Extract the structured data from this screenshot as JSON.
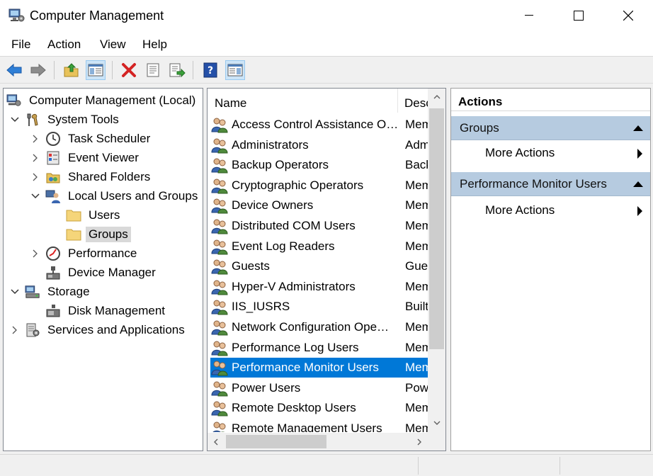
{
  "window": {
    "title": "Computer Management"
  },
  "menu": [
    "File",
    "Action",
    "View",
    "Help"
  ],
  "toolbar": [
    "back-icon",
    "forward-icon",
    "up-folder-icon",
    "show-hide-tree-icon",
    "delete-icon",
    "properties-icon",
    "export-list-icon",
    "help-icon",
    "show-hide-action-pane-icon"
  ],
  "tree": [
    {
      "label": "Computer Management (Local)",
      "icon": "computer-management-icon"
    },
    {
      "label": "System Tools",
      "icon": "system-tools-icon"
    },
    {
      "label": "Task Scheduler",
      "icon": "clock-icon"
    },
    {
      "label": "Event Viewer",
      "icon": "event-viewer-icon"
    },
    {
      "label": "Shared Folders",
      "icon": "shared-folder-icon"
    },
    {
      "label": "Local Users and Groups",
      "icon": "users-icon"
    },
    {
      "label": "Users",
      "icon": "folder-icon"
    },
    {
      "label": "Groups",
      "icon": "folder-icon"
    },
    {
      "label": "Performance",
      "icon": "performance-icon"
    },
    {
      "label": "Device Manager",
      "icon": "device-manager-icon"
    },
    {
      "label": "Storage",
      "icon": "storage-icon"
    },
    {
      "label": "Disk Management",
      "icon": "disk-icon"
    },
    {
      "label": "Services and Applications",
      "icon": "services-icon"
    }
  ],
  "list": {
    "columns": [
      "Name",
      "Desc"
    ],
    "rows": [
      {
        "name": "Access Control Assistance O…",
        "desc": "Mem"
      },
      {
        "name": "Administrators",
        "desc": "Adm"
      },
      {
        "name": "Backup Operators",
        "desc": "Back"
      },
      {
        "name": "Cryptographic Operators",
        "desc": "Mem"
      },
      {
        "name": "Device Owners",
        "desc": "Mem"
      },
      {
        "name": "Distributed COM Users",
        "desc": "Mem"
      },
      {
        "name": "Event Log Readers",
        "desc": "Mem"
      },
      {
        "name": "Guests",
        "desc": "Gue"
      },
      {
        "name": "Hyper-V Administrators",
        "desc": "Mem"
      },
      {
        "name": "IIS_IUSRS",
        "desc": "Built"
      },
      {
        "name": "Network Configuration Ope…",
        "desc": "Mem"
      },
      {
        "name": "Performance Log Users",
        "desc": "Mem"
      },
      {
        "name": "Performance Monitor Users",
        "desc": "Mem"
      },
      {
        "name": "Power Users",
        "desc": "Pow"
      },
      {
        "name": "Remote Desktop Users",
        "desc": "Mem"
      },
      {
        "name": "Remote Management Users",
        "desc": "Mem"
      }
    ],
    "selected_row": "Performance Monitor Users"
  },
  "actions": {
    "title": "Actions",
    "sections": [
      {
        "title": "Groups",
        "item": "More Actions"
      },
      {
        "title": "Performance Monitor Users",
        "item": "More Actions"
      }
    ]
  },
  "colors": {
    "selection": "#0078d7",
    "section_header": "#b6cbe0"
  }
}
